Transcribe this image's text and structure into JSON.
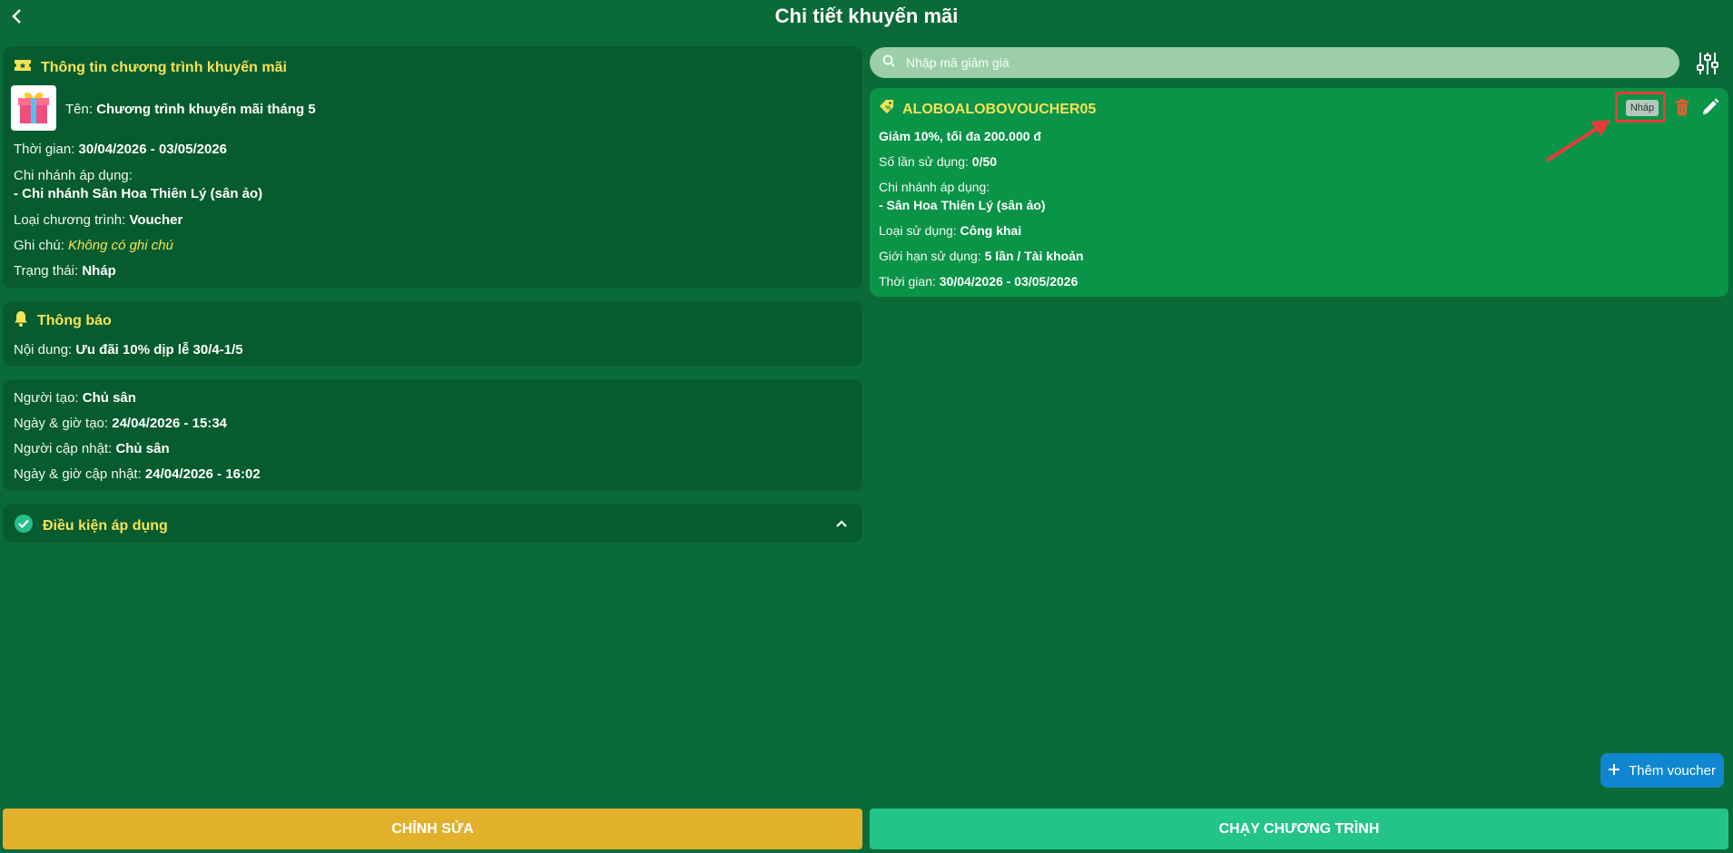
{
  "header": {
    "title": "Chi tiết khuyến mãi"
  },
  "info": {
    "title": "Thông tin chương trình khuyến mãi",
    "name_label": "Tên: ",
    "name_value": "Chương trình khuyến mãi tháng 5",
    "time_label": "Thời gian: ",
    "time_value": "30/04/2026 - 03/05/2026",
    "branch_label": "Chi nhánh áp dụng:",
    "branch_value": "- Chi nhánh Sân Hoa Thiên Lý (sân ảo)",
    "type_label": "Loại chương trình: ",
    "type_value": "Voucher",
    "note_label": "Ghi chú: ",
    "note_value": "Không có ghi chú",
    "status_label": "Trạng thái: ",
    "status_value": "Nháp"
  },
  "notice": {
    "title": "Thông báo",
    "content_label": "Nội dung: ",
    "content_value": "Ưu đãi 10% dịp lễ 30/4-1/5"
  },
  "audit": {
    "creator_label": "Người tạo: ",
    "creator_value": "Chủ sân",
    "created_label": "Ngày & giờ tạo: ",
    "created_value": "24/04/2026 - 15:34",
    "updater_label": "Người cập nhật: ",
    "updater_value": "Chủ sân",
    "updated_label": "Ngày & giờ cập nhật: ",
    "updated_value": "24/04/2026 - 16:02"
  },
  "conditions": {
    "title": "Điều kiện áp dụng"
  },
  "search": {
    "placeholder": "Nhập mã giảm giá"
  },
  "voucher": {
    "code": "ALOBOALOBOVOUCHER05",
    "status_badge": "Nháp",
    "discount": "Giảm 10%, tối đa 200.000 đ",
    "usage_label": "Số lần sử dụng: ",
    "usage_value": "0/50",
    "branch_label": "Chi nhánh áp dụng:",
    "branch_value": "- Sân Hoa Thiên Lý (sân ảo)",
    "use_type_label": "Loại sử dụng: ",
    "use_type_value": "Công khai",
    "limit_label": "Giới hạn sử dụng: ",
    "limit_value": "5 lần / Tài khoản",
    "time_label": "Thời gian: ",
    "time_value": "30/04/2026 - 03/05/2026"
  },
  "actions": {
    "add_voucher": "Thêm voucher",
    "edit": "CHỈNH SỬA",
    "run": "CHẠY CHƯƠNG TRÌNH"
  },
  "colors": {
    "background": "#0b6b38",
    "card": "#075c2f",
    "voucher_card": "#0a9448",
    "accent_yellow": "#f5e25a",
    "edit_button": "#e1b12c",
    "run_button": "#23c48a",
    "add_button": "#0f86cf",
    "highlight_red": "#ec3a3a"
  },
  "icons": [
    "back-arrow-icon",
    "ticket-icon",
    "gift-icon",
    "bell-icon",
    "check-circle-icon",
    "chevron-up-icon",
    "search-icon",
    "filter-sliders-icon",
    "tag-icon",
    "trash-icon",
    "pencil-icon",
    "plus-icon",
    "annotation-arrow"
  ]
}
